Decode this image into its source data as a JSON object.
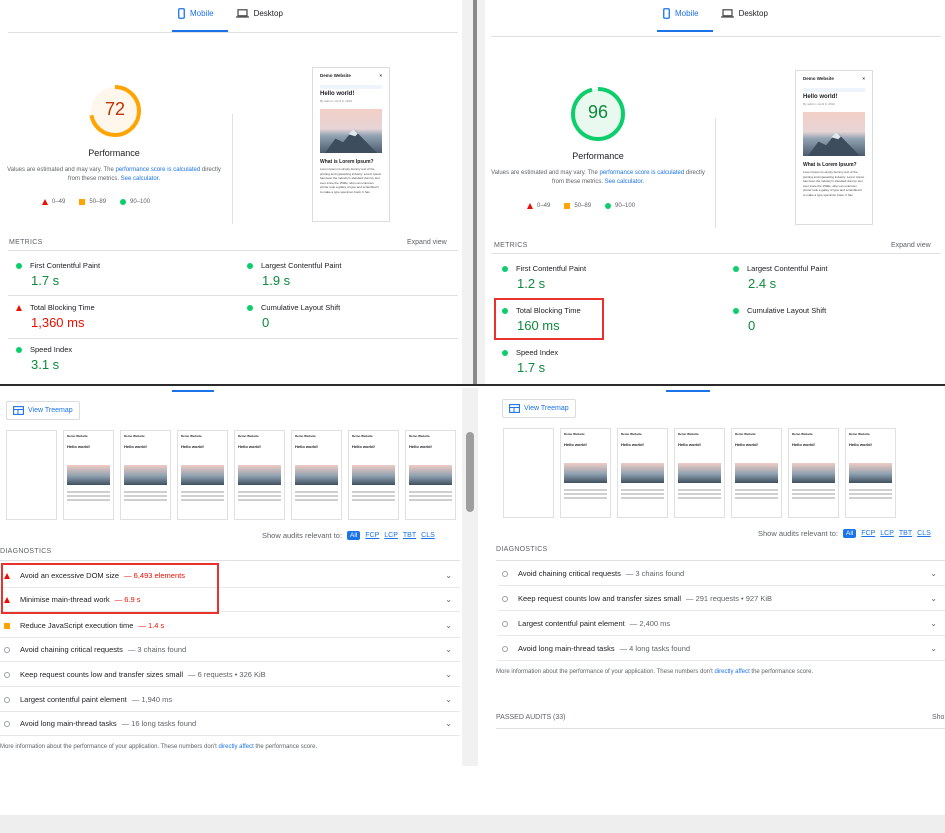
{
  "tabs": {
    "mobile": "Mobile",
    "desktop": "Desktop"
  },
  "colors": {
    "pass": "#0cce6b",
    "average": "#ffa400",
    "fail": "#eb0f00",
    "link": "#1a73e8"
  },
  "icons": {
    "mobile": "phone-icon",
    "desktop": "laptop-icon",
    "treemap": "treemap-icon"
  },
  "perf_label": "Performance",
  "desc": {
    "pre": "Values are estimated and may vary. The ",
    "link1": "performance score is calculated",
    "mid": " directly from these metrics. ",
    "link2": "See calculator."
  },
  "legend": {
    "fail": "0–49",
    "average": "50–89",
    "pass": "90–100"
  },
  "metrics_label": "METRICS",
  "expand_view": "Expand view",
  "metric_names": {
    "fcp": "First Contentful Paint",
    "lcp": "Largest Contentful Paint",
    "tbt": "Total Blocking Time",
    "cls": "Cumulative Layout Shift",
    "si": "Speed Index"
  },
  "preview": {
    "site": "Demo Website",
    "close": "×",
    "heading": "Hello world!",
    "meta": "By admin • April 9, 2024",
    "subheading": "What is Lorem Ipsum?",
    "text": "Lorem Ipsum is simply dummy text of the printing and typesetting industry. Lorem Ipsum has been the industry's standard dummy text ever since the 1500s, when an unknown printer took a galley of type and scrambled it to make a type specimen book. It has"
  },
  "before": {
    "score": "72",
    "fcp": "1.7 s",
    "lcp": "1.9 s",
    "tbt": "1,360 ms",
    "cls": "0",
    "si": "3.1 s"
  },
  "after": {
    "score": "96",
    "fcp": "1.2 s",
    "lcp": "2.4 s",
    "tbt": "160 ms",
    "cls": "0",
    "si": "1.7 s"
  },
  "treemap": "View Treemap",
  "show_audits": {
    "label": "Show audits relevant to:",
    "all": "All",
    "fcp": "FCP",
    "lcp": "LCP",
    "tbt": "TBT",
    "cls": "CLS"
  },
  "diagnostics_label": "DIAGNOSTICS",
  "before_audits": [
    {
      "title": "Avoid an excessive DOM size",
      "detail": "— 6,493 elements"
    },
    {
      "title": "Minimise main-thread work",
      "detail": "— 6.9 s"
    },
    {
      "title": "Reduce JavaScript execution time",
      "detail": "— 1.4 s"
    },
    {
      "title": "Avoid chaining critical requests",
      "detail": "— 3 chains found"
    },
    {
      "title": "Keep request counts low and transfer sizes small",
      "detail": "— 6 requests • 326 KiB"
    },
    {
      "title": "Largest contentful paint element",
      "detail": "— 1,940 ms"
    },
    {
      "title": "Avoid long main-thread tasks",
      "detail": "— 16 long tasks found"
    }
  ],
  "after_audits": [
    {
      "title": "Avoid chaining critical requests",
      "detail": "— 3 chains found"
    },
    {
      "title": "Keep request counts low and transfer sizes small",
      "detail": "— 291 requests • 927 KiB"
    },
    {
      "title": "Largest contentful paint element",
      "detail": "— 2,400 ms"
    },
    {
      "title": "Avoid long main-thread tasks",
      "detail": "— 4 long tasks found"
    }
  ],
  "more_info": {
    "pre": "More information about the performance of your application. These numbers don't ",
    "link": "directly affect",
    "post": " the performance score."
  },
  "passed_audits": "PASSED AUDITS (33)",
  "show_truncated": "Sho"
}
